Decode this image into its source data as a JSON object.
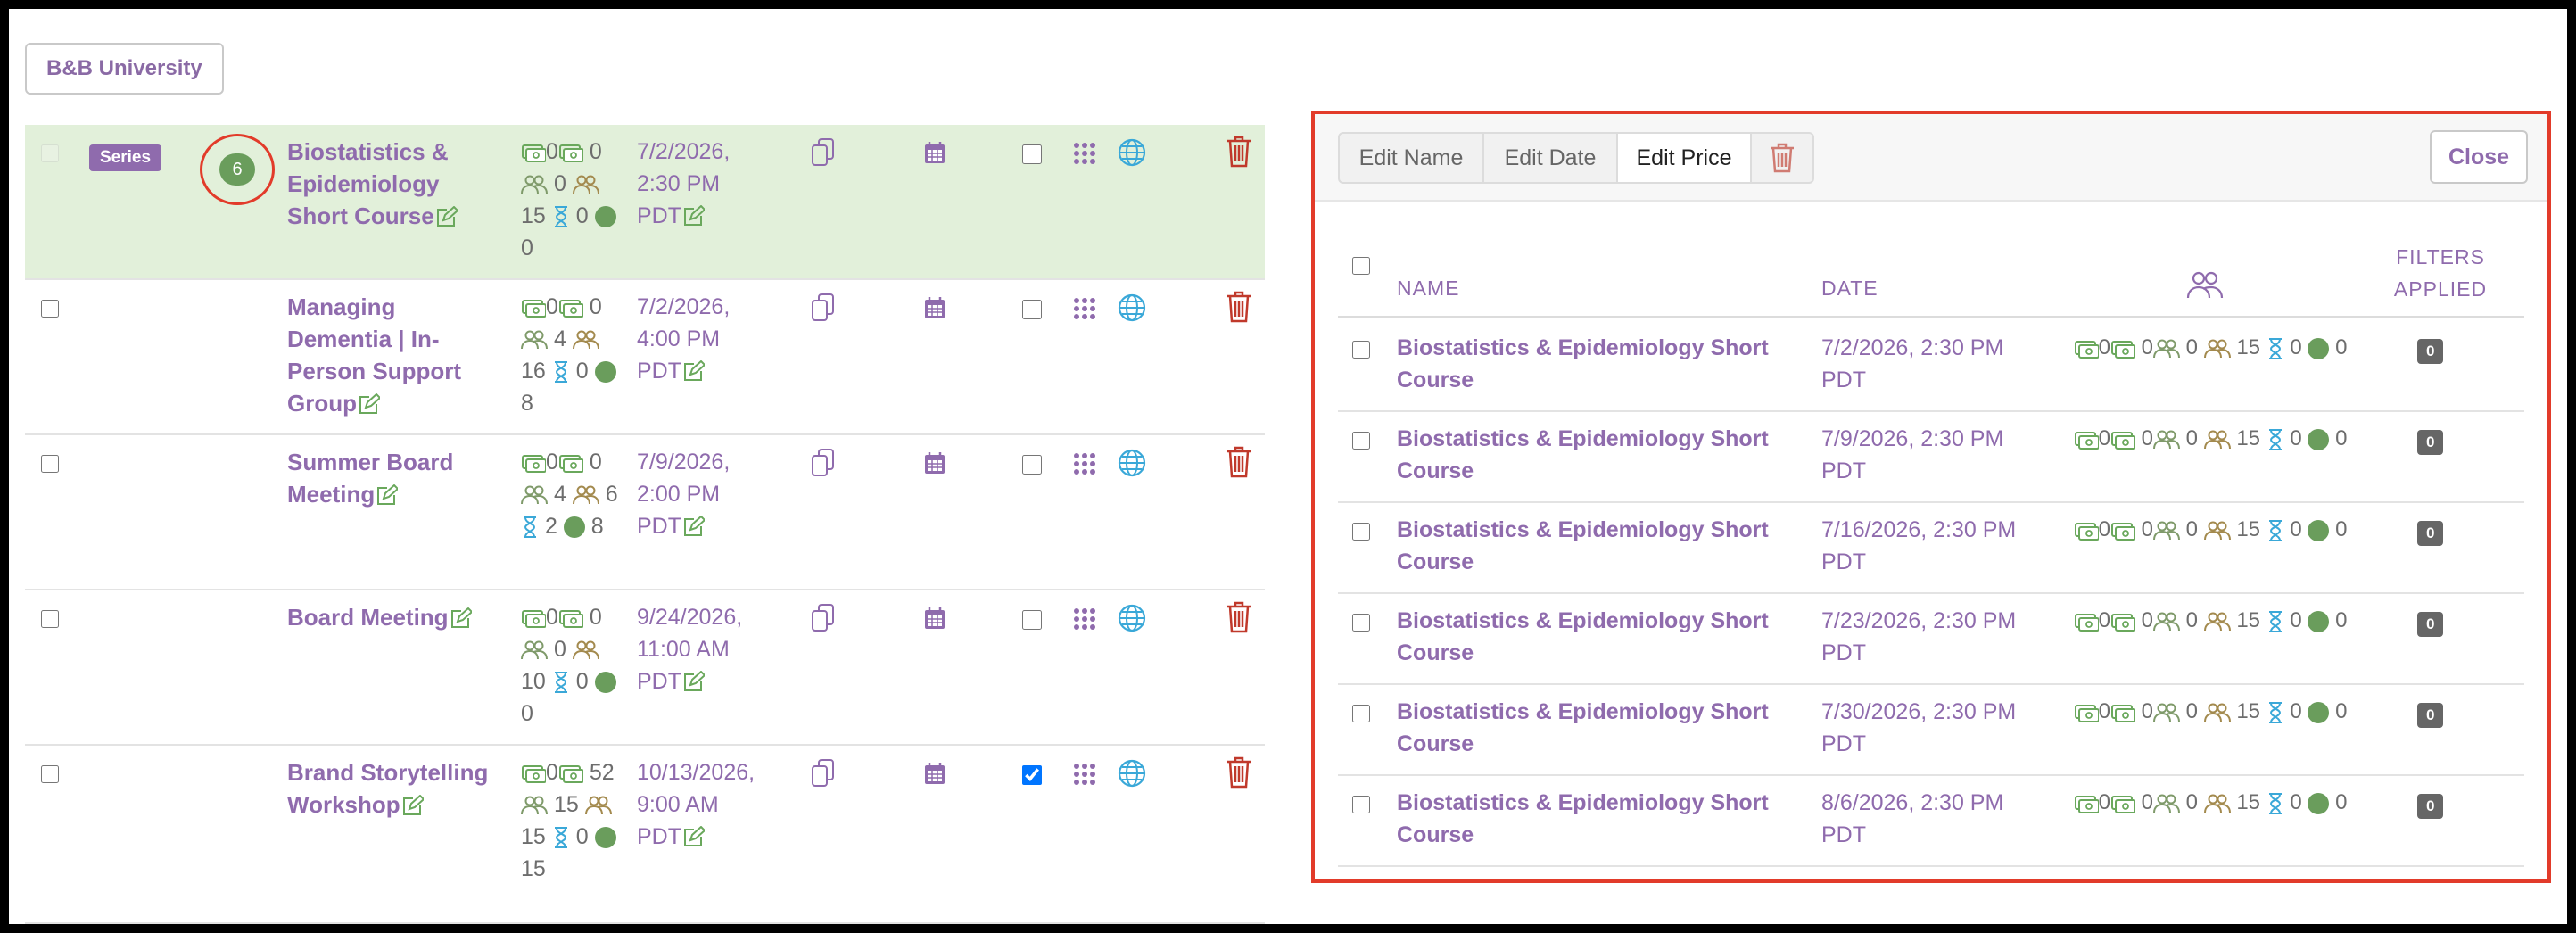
{
  "org_button": "B&B University",
  "colors": {
    "accent": "#8f6bad",
    "highlight": "#e2f0da",
    "badge": "#6a9d5c",
    "danger": "#c0392b",
    "outline": "#e23b2a"
  },
  "events": [
    {
      "name": "Biostatistics & Epidemiology Short Course",
      "series_label": "Series",
      "count": "6",
      "s": [
        "0",
        "0",
        "0",
        "15",
        "0",
        "0"
      ],
      "date_line1": "7/2/2026,",
      "date_line2": "2:30 PM",
      "date_line3": "PDT",
      "checked": false
    },
    {
      "name": "Managing Dementia | In-Person Support Group",
      "s": [
        "0",
        "0",
        "4",
        "16",
        "0",
        "8"
      ],
      "date_line1": "7/2/2026,",
      "date_line2": "4:00 PM",
      "date_line3": "PDT",
      "checked": false
    },
    {
      "name": "Summer Board Meeting",
      "s": [
        "0",
        "0",
        "4",
        "6",
        "2",
        "8"
      ],
      "date_line1": "7/9/2026,",
      "date_line2": "2:00 PM",
      "date_line3": "PDT",
      "checked": false
    },
    {
      "name": "Board Meeting",
      "s": [
        "0",
        "0",
        "0",
        "10",
        "0",
        "0"
      ],
      "date_line1": "9/24/2026,",
      "date_line2": "11:00 AM",
      "date_line3": "PDT",
      "checked": false
    },
    {
      "name": "Brand Storytelling Workshop",
      "s": [
        "0",
        "52",
        "15",
        "15",
        "0",
        "15"
      ],
      "date_line1": "10/13/2026,",
      "date_line2": "9:00 AM",
      "date_line3": "PDT",
      "checked": true
    }
  ],
  "panel": {
    "toolbar": {
      "edit_name": "Edit Name",
      "edit_date": "Edit Date",
      "edit_price": "Edit Price",
      "close": "Close"
    },
    "headers": {
      "name": "NAME",
      "date": "DATE",
      "filters_line1": "FILTERS",
      "filters_line2": "APPLIED"
    },
    "rows": [
      {
        "name": "Biostatistics & Epidemiology Short Course",
        "date_line1": "7/2/2026, 2:30 PM",
        "date_line2": "PDT",
        "s": [
          "0",
          "0",
          "0",
          "15",
          "0",
          "0"
        ],
        "filters": "0"
      },
      {
        "name": "Biostatistics & Epidemiology Short Course",
        "date_line1": "7/9/2026, 2:30 PM",
        "date_line2": "PDT",
        "s": [
          "0",
          "0",
          "0",
          "15",
          "0",
          "0"
        ],
        "filters": "0"
      },
      {
        "name": "Biostatistics & Epidemiology Short Course",
        "date_line1": "7/16/2026, 2:30 PM",
        "date_line2": "PDT",
        "s": [
          "0",
          "0",
          "0",
          "15",
          "0",
          "0"
        ],
        "filters": "0"
      },
      {
        "name": "Biostatistics & Epidemiology Short Course",
        "date_line1": "7/23/2026, 2:30 PM",
        "date_line2": "PDT",
        "s": [
          "0",
          "0",
          "0",
          "15",
          "0",
          "0"
        ],
        "filters": "0"
      },
      {
        "name": "Biostatistics & Epidemiology Short Course",
        "date_line1": "7/30/2026, 2:30 PM",
        "date_line2": "PDT",
        "s": [
          "0",
          "0",
          "0",
          "15",
          "0",
          "0"
        ],
        "filters": "0"
      },
      {
        "name": "Biostatistics & Epidemiology Short Course",
        "date_line1": "8/6/2026, 2:30 PM",
        "date_line2": "PDT",
        "s": [
          "0",
          "0",
          "0",
          "15",
          "0",
          "0"
        ],
        "filters": "0"
      }
    ]
  }
}
